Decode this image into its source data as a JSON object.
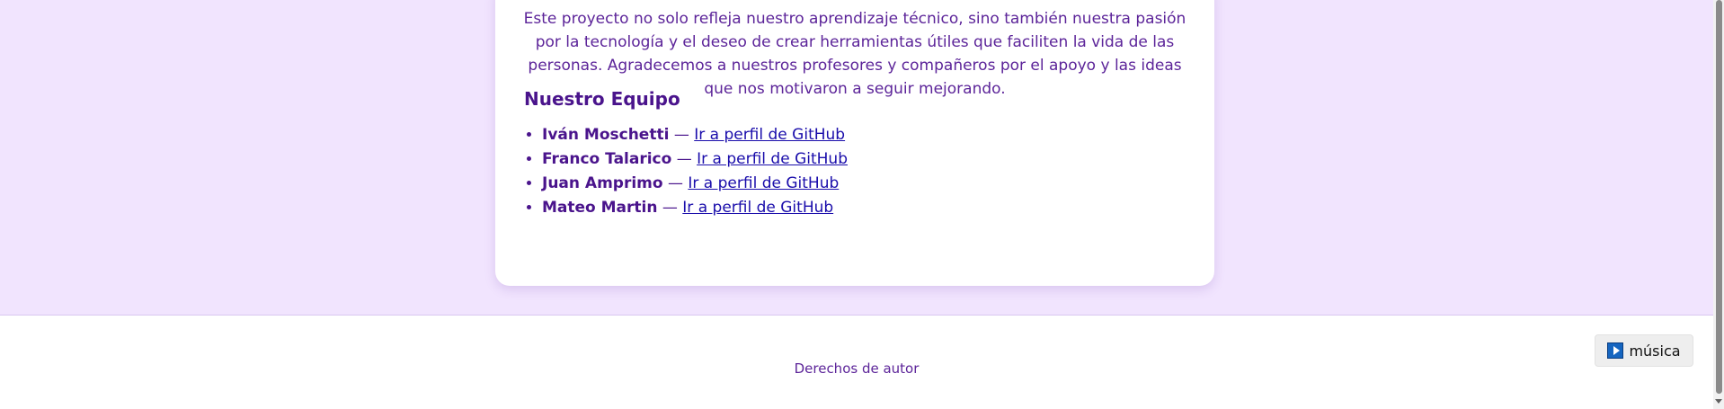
{
  "about": {
    "paragraph": "Este proyecto no solo refleja nuestro aprendizaje técnico, sino también nuestra pasión por la tecnología y el deseo de crear herramientas útiles que faciliten la vida de las personas. Agradecemos a nuestros profesores y compañeros por el apoyo y las ideas que nos motivaron a seguir mejorando."
  },
  "team": {
    "title": "Nuestro Equipo",
    "separator": "—",
    "members": [
      {
        "name": "Iván Moschetti",
        "link_text": "Ir a perfil de GitHub"
      },
      {
        "name": "Franco Talarico",
        "link_text": "Ir a perfil de GitHub"
      },
      {
        "name": "Juan Amprimo",
        "link_text": "Ir a perfil de GitHub"
      },
      {
        "name": "Mateo Martin",
        "link_text": "Ir a perfil de GitHub"
      }
    ]
  },
  "footer": {
    "text": "Derechos de autor"
  },
  "music_button": {
    "label": "música",
    "icon": "play-icon"
  },
  "colors": {
    "page_background": "#f1e4fe",
    "accent_text": "#4a148c",
    "link": "#1a0dab"
  }
}
